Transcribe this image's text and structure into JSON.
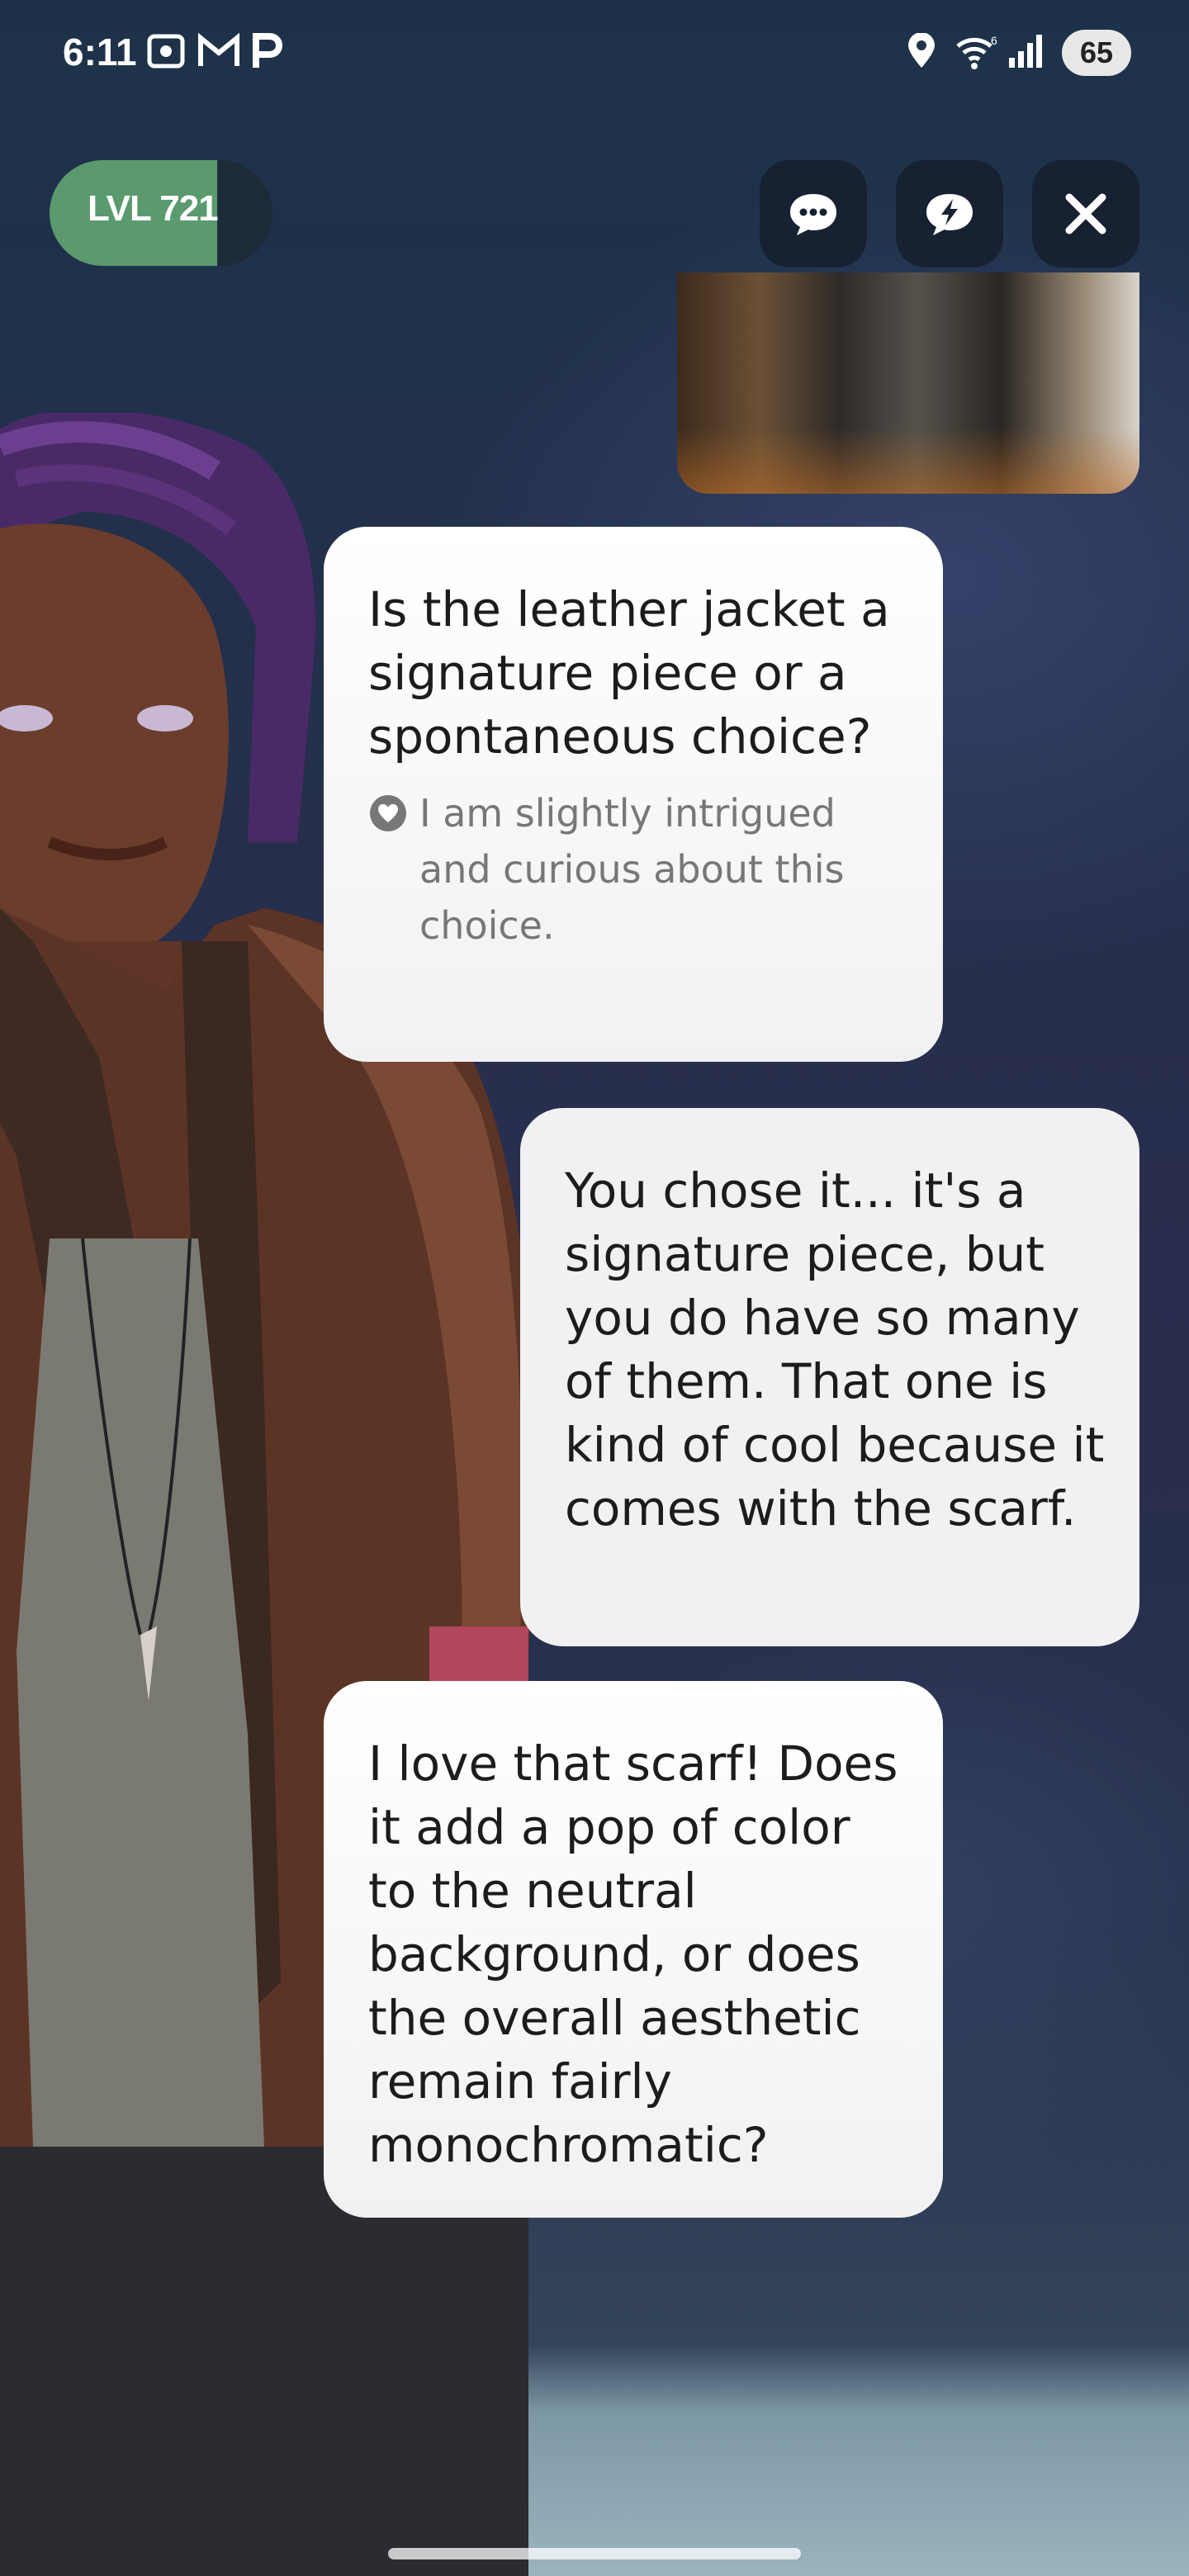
{
  "status_bar": {
    "time": "6:11",
    "battery": "65",
    "notification_icons": [
      "screenshot-icon",
      "gmail-icon",
      "p-app-icon"
    ],
    "system_icons": [
      "location-icon",
      "wifi-icon",
      "signal-icon",
      "battery-icon"
    ]
  },
  "level": {
    "label": "LVL 721",
    "progress_fraction": 0.75
  },
  "top_actions": [
    "chat-icon",
    "quick-reply-icon",
    "close-icon"
  ],
  "chat": {
    "messages": [
      {
        "side": "left",
        "text": "Is the leather jacket a signature piece or a spontaneous choice?",
        "thought": "I am slightly intrigued and curious about this choice."
      },
      {
        "side": "right",
        "text": "You chose it... it's a signature piece, but you do have so many of them. That one is kind of cool because it comes with the scarf."
      },
      {
        "side": "left",
        "text": "I love that scarf! Does it add a pop of color to the neutral background, or does the overall aesthetic remain fairly monochromatic?"
      }
    ]
  },
  "colors": {
    "level_fill": "#5a9a6e",
    "button_bg": "#162232",
    "bubble_bg": "#ffffff"
  }
}
